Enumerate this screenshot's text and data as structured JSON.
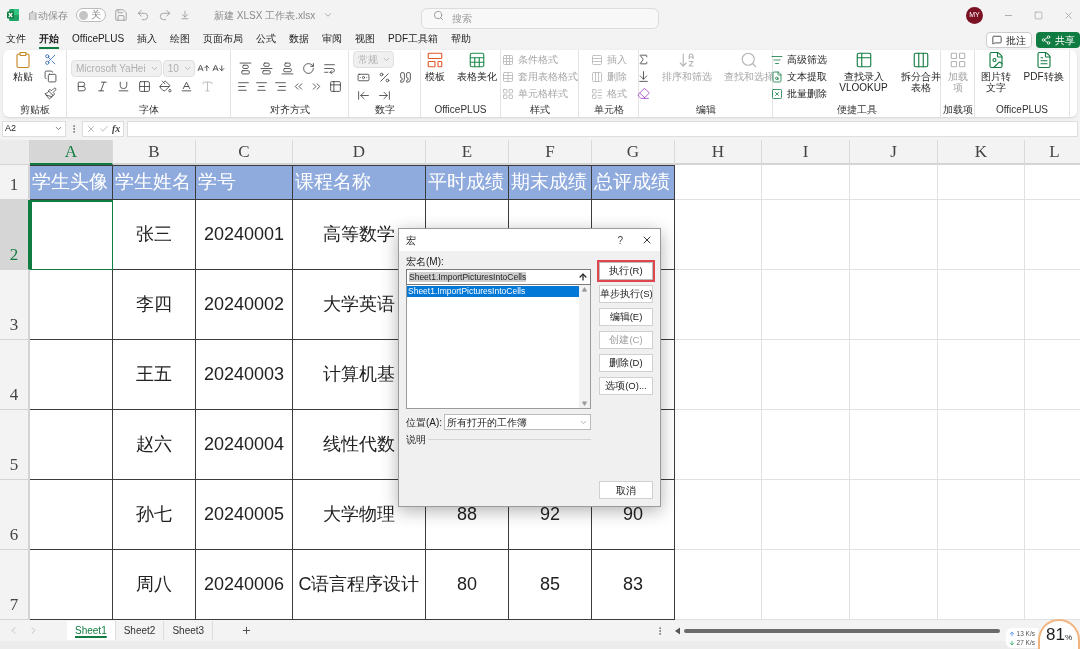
{
  "title_bar": {
    "autosave_label": "自动保存",
    "autosave_toggle": {
      "on": false,
      "label": "关"
    },
    "document_title": "新建 XLSX 工作表.xlsx",
    "search": {
      "placeholder": "搜索"
    },
    "avatar": "MY"
  },
  "menu_tabs": [
    {
      "label": "文件",
      "selected": false
    },
    {
      "label": "开始",
      "selected": true
    },
    {
      "label": "OfficePLUS",
      "selected": false
    },
    {
      "label": "插入",
      "selected": false
    },
    {
      "label": "绘图",
      "selected": false
    },
    {
      "label": "页面布局",
      "selected": false
    },
    {
      "label": "公式",
      "selected": false
    },
    {
      "label": "数据",
      "selected": false
    },
    {
      "label": "审阅",
      "selected": false
    },
    {
      "label": "视图",
      "selected": false
    },
    {
      "label": "PDF工具箱",
      "selected": false
    },
    {
      "label": "帮助",
      "selected": false
    }
  ],
  "comment_button": "批注",
  "share_button": "共享",
  "ribbon": [
    {
      "label": "剪贴板",
      "kind": "columns",
      "lines": [
        [
          {
            "kind": "large",
            "label": "粘贴",
            "disabled": false
          }
        ],
        [
          {
            "kind": "icon",
            "disabled": false
          },
          {
            "kind": "icon",
            "disabled": false
          },
          {
            "kind": "icon",
            "disabled": false
          }
        ]
      ]
    },
    {
      "label": "字体",
      "kind": "rows",
      "lines": [
        [
          {
            "kind": "field",
            "value": "Microsoft YaHei",
            "disabled": true
          },
          {
            "kind": "field",
            "value": "10",
            "disabled": true
          },
          {
            "kind": "icon",
            "disabled": false
          },
          {
            "kind": "icon",
            "disabled": false
          }
        ],
        [
          {
            "kind": "icon",
            "disabled": false
          },
          {
            "kind": "icon",
            "disabled": false
          },
          {
            "kind": "icon",
            "disabled": false
          },
          {
            "kind": "icon",
            "disabled": false
          },
          {
            "kind": "icon",
            "disabled": false
          },
          {
            "kind": "icon",
            "disabled": false
          },
          {
            "kind": "icon",
            "disabled": true
          }
        ]
      ]
    },
    {
      "label": "对齐方式",
      "kind": "rows",
      "lines": [
        [
          {
            "kind": "icon",
            "disabled": false
          },
          {
            "kind": "icon",
            "disabled": false
          },
          {
            "kind": "icon",
            "disabled": false
          },
          {
            "kind": "icon",
            "disabled": false
          },
          {
            "kind": "icon",
            "disabled": false
          }
        ],
        [
          {
            "kind": "icon",
            "disabled": false
          },
          {
            "kind": "icon",
            "disabled": false
          },
          {
            "kind": "icon",
            "disabled": false
          },
          {
            "kind": "icon",
            "disabled": false
          },
          {
            "kind": "icon",
            "disabled": false
          },
          {
            "kind": "icon",
            "disabled": false
          }
        ]
      ]
    },
    {
      "label": "数字",
      "kind": "rows",
      "lines": [
        [
          {
            "kind": "field",
            "value": "常规",
            "disabled": true
          }
        ],
        [
          {
            "kind": "icon",
            "disabled": false
          },
          {
            "kind": "icon",
            "disabled": false
          },
          {
            "kind": "icon",
            "disabled": false
          }
        ],
        [
          {
            "kind": "icon",
            "disabled": false
          },
          {
            "kind": "icon",
            "disabled": false
          }
        ]
      ]
    },
    {
      "label": "OfficePLUS",
      "kind": "columns",
      "lines": [
        [
          {
            "kind": "large",
            "label": "模板",
            "disabled": false
          }
        ],
        [
          {
            "kind": "large",
            "label": "表格美化",
            "disabled": false
          }
        ]
      ]
    },
    {
      "label": "样式",
      "kind": "columns",
      "lines": [
        [
          {
            "kind": "small",
            "label": "条件格式",
            "disabled": true
          },
          {
            "kind": "small",
            "label": "套用表格格式",
            "disabled": true
          },
          {
            "kind": "small",
            "label": "单元格样式",
            "disabled": true
          }
        ]
      ]
    },
    {
      "label": "单元格",
      "kind": "columns",
      "lines": [
        [
          {
            "kind": "small",
            "label": "插入",
            "disabled": true
          },
          {
            "kind": "small",
            "label": "删除",
            "disabled": true
          },
          {
            "kind": "small",
            "label": "格式",
            "disabled": true
          }
        ]
      ]
    },
    {
      "label": "编辑",
      "kind": "columns",
      "lines": [
        [
          {
            "kind": "icon",
            "disabled": false
          },
          {
            "kind": "icon",
            "disabled": false
          },
          {
            "kind": "icon",
            "disabled": false
          }
        ],
        [
          {
            "kind": "large",
            "label": "排序和筛选",
            "disabled": true
          }
        ],
        [
          {
            "kind": "large",
            "label": "查找和选择",
            "disabled": true
          }
        ]
      ]
    },
    {
      "label": "便捷工具",
      "kind": "columns",
      "lines": [
        [
          {
            "kind": "small",
            "label": "高级筛选",
            "disabled": false
          },
          {
            "kind": "small",
            "label": "文本提取",
            "disabled": false
          },
          {
            "kind": "small",
            "label": "批量删除",
            "disabled": false
          }
        ],
        [
          {
            "kind": "large",
            "label": "查找录入\nVLOOKUP",
            "disabled": false
          }
        ],
        [
          {
            "kind": "large",
            "label": "拆分合并表格",
            "disabled": false
          }
        ]
      ]
    },
    {
      "label": "加载项",
      "kind": "columns",
      "lines": [
        [
          {
            "kind": "large",
            "label": "加载项",
            "disabled": true
          }
        ]
      ]
    },
    {
      "label": "OfficePLUS",
      "kind": "columns",
      "lines": [
        [
          {
            "kind": "large",
            "label": "图片转文字",
            "disabled": false
          }
        ],
        [
          {
            "kind": "large",
            "label": "PDF转换",
            "disabled": false
          }
        ]
      ]
    }
  ],
  "formula_bar": {
    "name_box": "A2",
    "function_label": "fx"
  },
  "columns": [
    {
      "label": "A",
      "selected": true
    },
    {
      "label": "B",
      "selected": false
    },
    {
      "label": "C",
      "selected": false
    },
    {
      "label": "D",
      "selected": false
    },
    {
      "label": "E",
      "selected": false
    },
    {
      "label": "F",
      "selected": false
    },
    {
      "label": "G",
      "selected": false
    },
    {
      "label": "H",
      "selected": false
    },
    {
      "label": "I",
      "selected": false
    },
    {
      "label": "J",
      "selected": false
    },
    {
      "label": "K",
      "selected": false
    },
    {
      "label": "L",
      "selected": false
    }
  ],
  "header_row": {
    "number": "1",
    "selected": false,
    "cells": [
      "学生头像",
      "学生姓名",
      "学号",
      "课程名称",
      "平时成绩",
      "期末成绩",
      "总评成绩"
    ]
  },
  "rows": [
    {
      "number": "2",
      "selected": true,
      "student_name": "张三",
      "student_id": "20240001",
      "course": "高等数学"
    },
    {
      "number": "3",
      "selected": false,
      "student_name": "李四",
      "student_id": "20240002",
      "course": "大学英语"
    },
    {
      "number": "4",
      "selected": false,
      "student_name": "王五",
      "student_id": "20240003",
      "course": "计算机基"
    },
    {
      "number": "5",
      "selected": false,
      "student_name": "赵六",
      "student_id": "20240004",
      "course": "线性代数"
    },
    {
      "number": "6",
      "selected": false,
      "student_name": "孙七",
      "student_id": "20240005",
      "course": "大学物理",
      "regular_score": "88",
      "final_score": "92",
      "total_score": "90"
    },
    {
      "number": "7",
      "selected": false,
      "student_name": "周八",
      "student_id": "20240006",
      "course": "C语言程序设计",
      "regular_score": "80",
      "final_score": "85",
      "total_score": "83"
    }
  ],
  "macro_dialog": {
    "title": "宏",
    "help_button": "?",
    "macro_name_label": "宏名(M):",
    "macro_name_value": "Sheet1.ImportPicturesIntoCells",
    "macros": [
      {
        "label": "Sheet1.ImportPicturesIntoCells",
        "selected": true
      }
    ],
    "buttons": [
      {
        "label": "执行(R)",
        "highlighted": true,
        "disabled": false
      },
      {
        "label": "单步执行(S)",
        "highlighted": false,
        "disabled": false
      },
      {
        "label": "编辑(E)",
        "highlighted": false,
        "disabled": false
      },
      {
        "label": "创建(C)",
        "highlighted": false,
        "disabled": true
      },
      {
        "label": "删除(D)",
        "highlighted": false,
        "disabled": false
      },
      {
        "label": "选项(O)...",
        "highlighted": false,
        "disabled": false
      }
    ],
    "location_label": "位置(A):",
    "location_value": "所有打开的工作簿",
    "description_label": "说明",
    "cancel_button": "取消"
  },
  "sheet_tabs": [
    {
      "label": "Sheet1",
      "selected": true
    },
    {
      "label": "Sheet2",
      "selected": false
    },
    {
      "label": "Sheet3",
      "selected": false
    }
  ],
  "speed_widget": {
    "upload": "13 K/s",
    "download": "27 K/s",
    "load": "81",
    "load_unit": "%"
  }
}
